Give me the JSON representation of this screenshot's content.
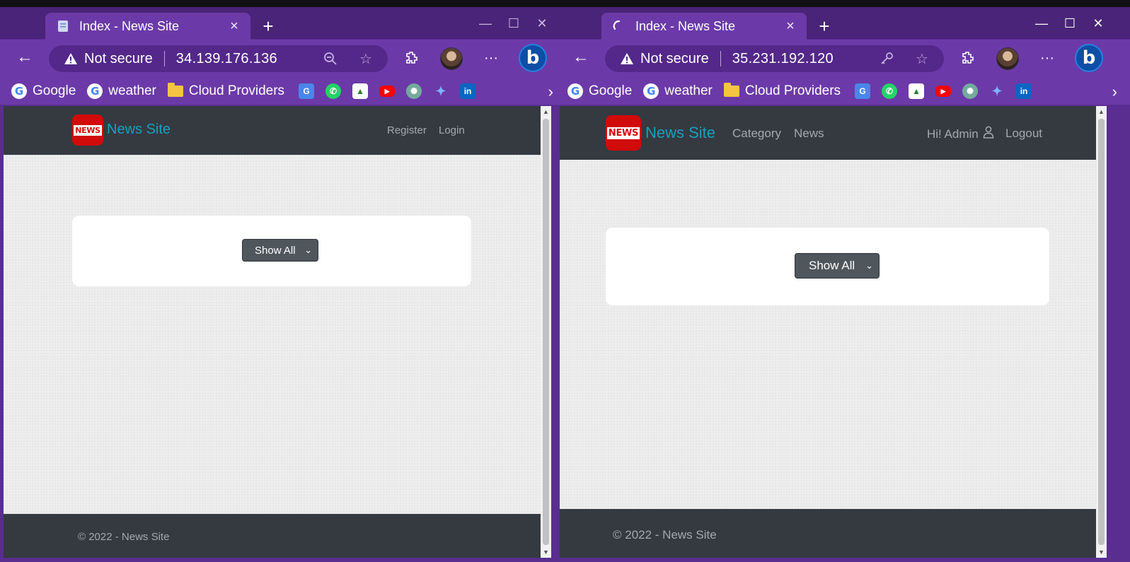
{
  "colors": {
    "window_frame": "#5a2d91",
    "toolbar": "#6b3aa8",
    "navbar": "#343a40",
    "brand": "#1a9fbf",
    "logo_red": "#d10a0a"
  },
  "left_window": {
    "tab": {
      "title": "Index - News Site",
      "favicon": "page-icon"
    },
    "address": {
      "security": "Not secure",
      "url": "34.139.176.136"
    },
    "bookmarks": [
      "Google",
      "weather",
      "Cloud Providers"
    ],
    "page": {
      "brand": "News Site",
      "logo_text": "NEWS",
      "nav": [
        "Register",
        "Login"
      ],
      "select_value": "Show All",
      "footer": "© 2022 - News Site"
    }
  },
  "right_window": {
    "tab": {
      "title": "Index - News Site",
      "favicon": "loading-icon"
    },
    "address": {
      "security": "Not secure",
      "url": "35.231.192.120"
    },
    "bookmarks": [
      "Google",
      "weather",
      "Cloud Providers"
    ],
    "page": {
      "brand": "News Site",
      "logo_text": "NEWS",
      "nav": [
        "Category",
        "News"
      ],
      "greeting": "Hi! Admin",
      "logout": "Logout",
      "select_value": "Show All",
      "footer": "© 2022 - News Site"
    }
  }
}
